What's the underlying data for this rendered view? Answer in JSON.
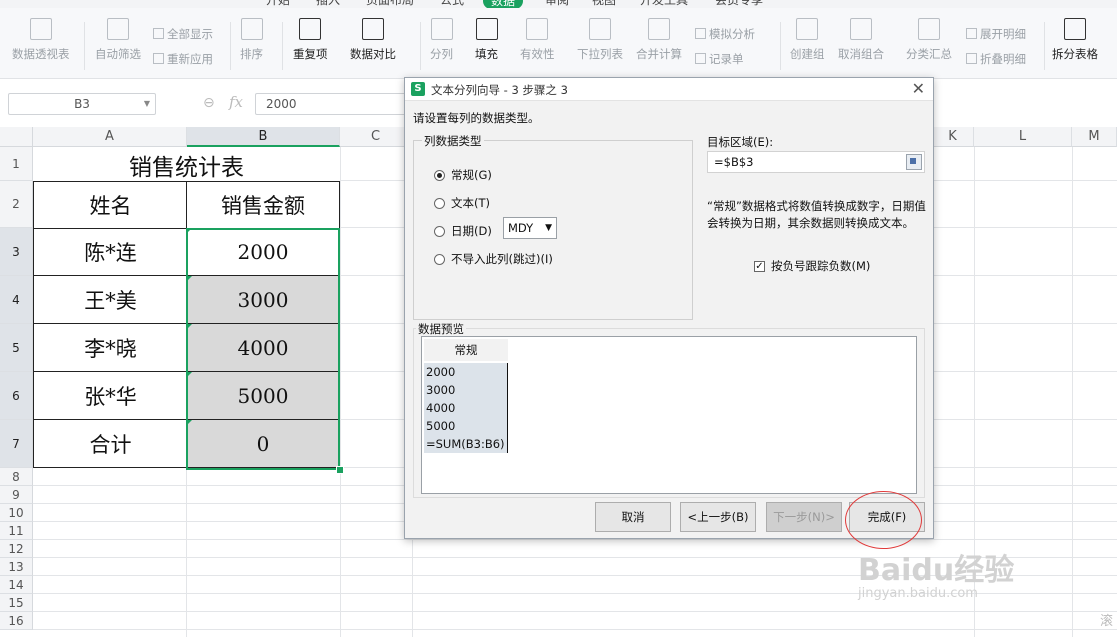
{
  "menu_tabs": [
    "开始",
    "插入",
    "页面布局",
    "公式",
    "数据",
    "审阅",
    "视图",
    "开发工具",
    "会员专享"
  ],
  "active_tab": "数据",
  "ribbon": {
    "pivot": "数据透视表",
    "autofilter": "自动筛选",
    "show_all": "全部显示",
    "reapply": "重新应用",
    "sort": "排序",
    "duplicates": "重复项",
    "compare": "数据对比",
    "split": "分列",
    "fill": "填充",
    "validity": "有效性",
    "dropdown": "下拉列表",
    "consolidate": "合并计算",
    "simulate": "模拟分析",
    "record": "记录单",
    "group": "创建组",
    "ungroup": "取消组合",
    "subtotal": "分类汇总",
    "expand": "展开明细",
    "collapse": "折叠明细",
    "split_table": "拆分表格"
  },
  "formula_bar": {
    "name_box": "B3",
    "fx": "fx",
    "value": "2000"
  },
  "columns": [
    "A",
    "B",
    "C",
    "K",
    "L",
    "M"
  ],
  "rows": [
    "1",
    "2",
    "3",
    "4",
    "5",
    "6",
    "7",
    "8",
    "9",
    "10",
    "11",
    "12",
    "13",
    "14",
    "15",
    "16"
  ],
  "sheet": {
    "title": "销售统计表",
    "header_name": "姓名",
    "header_amount": "销售金额",
    "names": [
      "陈*连",
      "王*美",
      "李*晓",
      "张*华",
      "合计"
    ],
    "amounts": [
      "2000",
      "3000",
      "4000",
      "5000",
      "0"
    ]
  },
  "dialog": {
    "title": "文本分列向导 - 3 步骤之 3",
    "instruction": "请设置每列的数据类型。",
    "group_label": "列数据类型",
    "radio_general": "常规(G)",
    "radio_text": "文本(T)",
    "radio_date": "日期(D)",
    "date_format": "MDY",
    "radio_skip": "不导入此列(跳过)(I)",
    "target_label": "目标区域(E):",
    "target_value": "=$B$3",
    "description": "“常规”数据格式将数值转换成数字，日期值会转换为日期，其余数据则转换成文本。",
    "checkbox_label": "按负号跟踪负数(M)",
    "preview_label": "数据预览",
    "preview_header": "常规",
    "preview_rows": [
      "2000",
      "3000",
      "4000",
      "5000",
      "=SUM(B3:B6)"
    ],
    "btn_cancel": "取消",
    "btn_back": "<上一步(B)",
    "btn_next": "下一步(N)>",
    "btn_finish": "完成(F)"
  },
  "watermark": {
    "logo": "Baidu经验",
    "url": "jingyan.baidu.com"
  },
  "corner_char": "滚"
}
